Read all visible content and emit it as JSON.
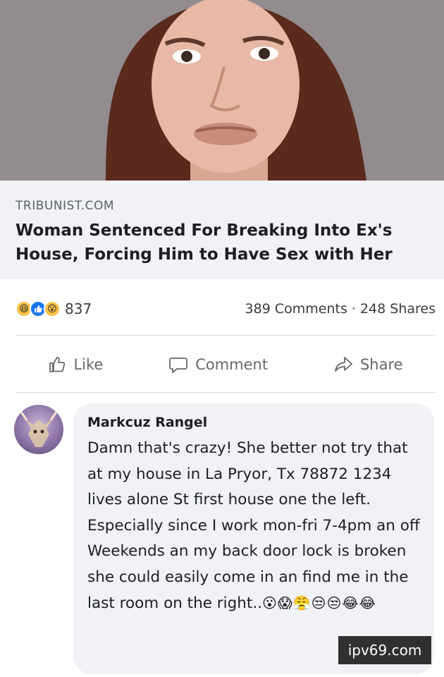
{
  "link": {
    "domain": "TRIBUNIST.COM",
    "title": "Woman Sentenced For Breaking Into Ex's House, Forcing Him to Have Sex with Her"
  },
  "reactions": {
    "icons": [
      "haha-icon",
      "like-icon",
      "wow-icon"
    ],
    "count": "837",
    "comments_shares": "389 Comments · 248 Shares"
  },
  "actions": {
    "like": "Like",
    "comment": "Comment",
    "share": "Share"
  },
  "comment": {
    "author": "Markcuz Rangel",
    "text": "Damn that's crazy! She better not try that at my house in La Pryor, Tx 78872 1234 lives alone St first house one the left. Especially since I work mon-fri 7-4pm an off Weekends an my back door lock is broken she could easily come in an find me in the last room on the right..",
    "emojis": "😮😱😤😒😒😂😂"
  },
  "watermark": "ipv69.com",
  "colors": {
    "link_box_bg": "#f0f2f5",
    "like_blue": "#1877f2",
    "reaction_yellow": "#f7c24a",
    "muted_text": "#65676b"
  }
}
